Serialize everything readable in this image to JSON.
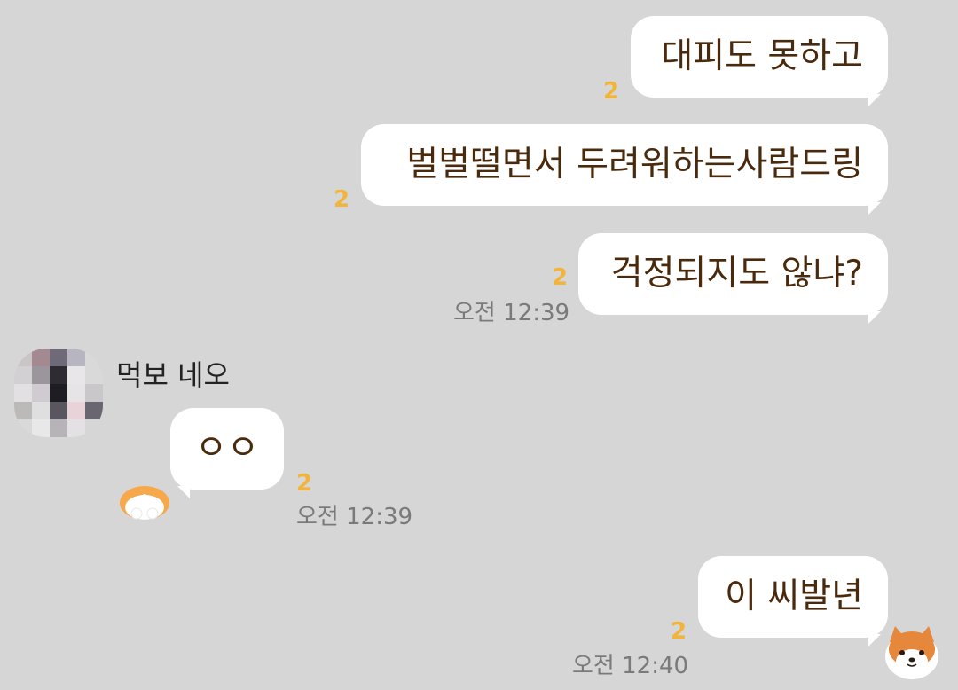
{
  "messages": {
    "m1": {
      "text": "대피도 못하고",
      "unread": "2"
    },
    "m2": {
      "text": "벌벌떨면서 두려워하는사람드링",
      "unread": "2"
    },
    "m3": {
      "text": "걱정되지도 않냐?",
      "unread": "2",
      "time": "오전 12:39"
    },
    "sender_name": "먹보 네오",
    "m4": {
      "text": "ㅇㅇ",
      "unread": "2",
      "time": "오전 12:39"
    },
    "m5": {
      "text": "이 씨발년",
      "unread": "2",
      "time": "오전 12:40"
    }
  },
  "icons": {
    "avatar": "pixelated-avatar-icon",
    "emoticon_corgi": "corgi-emoticon-icon",
    "emoticon_shiba": "shiba-emoticon-icon"
  },
  "colors": {
    "background": "#d6d6d6",
    "bubble": "#ffffff",
    "text": "#4a2a0d",
    "unread": "#f2b53c",
    "time": "#7a7a7a"
  }
}
